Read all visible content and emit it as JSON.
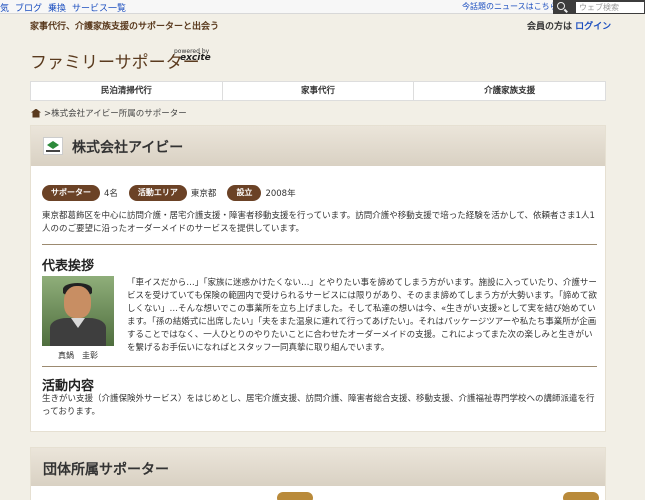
{
  "topbar": {
    "links": [
      "気",
      "ブログ",
      "乗換",
      "サービス一覧"
    ],
    "news": "今話題のニュースはこちら",
    "search_placeholder": "ウェブ検索"
  },
  "tagline": "家事代行、介護家族支援のサポーターと出会う",
  "member": {
    "prefix": "会員の方は",
    "login": "ログイン"
  },
  "logo": {
    "title": "ファミリーサポーター",
    "powered_by": "powered by",
    "brand": "excite"
  },
  "nav": [
    "民泊清掃代行",
    "家事代行",
    "介護家族支援"
  ],
  "breadcrumb": ">株式会社アイビー所属のサポーター",
  "company": {
    "name": "株式会社アイビー",
    "info": [
      {
        "label": "サポーター",
        "value": "4名"
      },
      {
        "label": "活動エリア",
        "value": "東京都"
      },
      {
        "label": "設立",
        "value": "2008年"
      }
    ],
    "description": "東京都葛飾区を中心に訪問介護・居宅介護支援・障害者移動支援を行っています。訪問介護や移動支援で培った経験を活かして、依頼者さま1人1人ののご要望に沿ったオーダーメイドのサービスを提供しています。"
  },
  "greeting": {
    "heading": "代表挨拶",
    "name": "真鍋　圭彰",
    "text": "「車イスだから…」「家族に迷惑かけたくない…」とやりたい事を諦めてしまう方がいます。施設に入っていたり、介護サービスを受けていても保険の範囲内で受けられるサービスには限りがあり、そのまま諦めてしまう方が大勢います。「諦めて欲しくない」…そんな想いでこの事業所を立ち上げました。そして私達の想いは今、«生きがい支援»として実を結び始めています。「孫の結婚式に出席したい」「夫をまた温泉に連れて行ってあげたい」。それはパッケージツアーや私たち事業所が企画することではなく、一人ひとりのやりたいことに合わせたオーダーメイドの支援。これによってまた次の楽しみと生きがいを繋げるお手伝いになればとスタッフ一同真摯に取り組んでいます。"
  },
  "activity": {
    "heading": "活動内容",
    "text": "生きがい支援（介護保険外サービス）をはじめとし、居宅介護支援、訪問介護、障害者総合支援、移動支援、介護福祉専門学校への講師派遣を行っております。"
  },
  "group": {
    "heading": "団体所属サポーター"
  },
  "colors": {
    "accent_brown": "#6b4226",
    "link_blue": "#1a4dbf",
    "page_bg": "#f2efe6"
  }
}
